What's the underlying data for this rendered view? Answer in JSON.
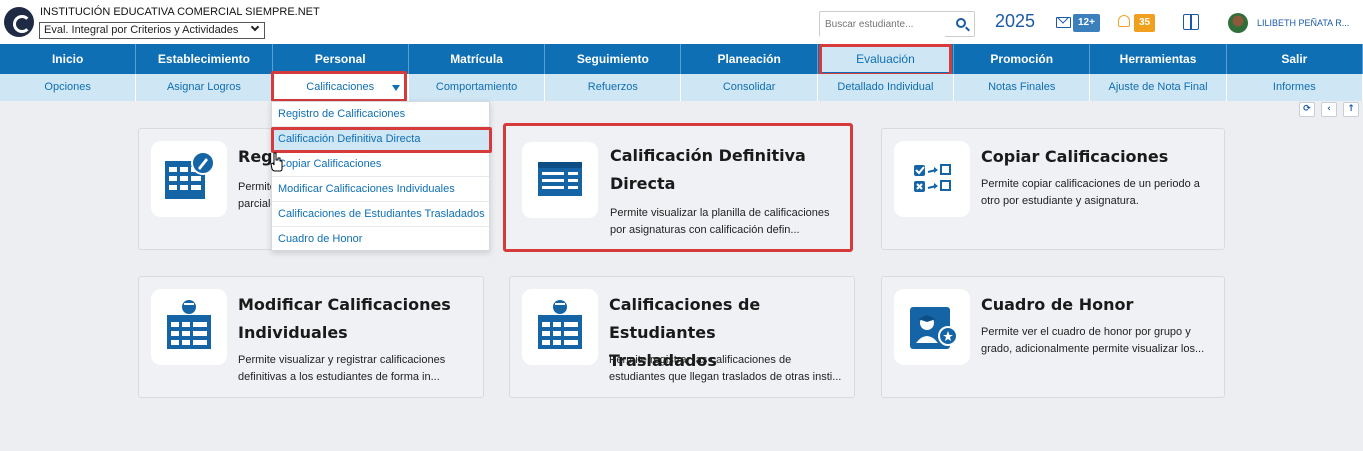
{
  "header": {
    "institution": "INSTITUCIÓN EDUCATIVA COMERCIAL SIEMPRE.NET",
    "period_select": "Eval. Integral por Criterios y Actividades",
    "search_placeholder": "Buscar estudiante...",
    "year": "2025",
    "messages_badge": "12+",
    "notifications_badge": "35",
    "user_name": "LILIBETH PEÑATA R..."
  },
  "nav": {
    "items": [
      "Inicio",
      "Establecimiento",
      "Personal",
      "Matrícula",
      "Seguimiento",
      "Planeación",
      "Evaluación",
      "Promoción",
      "Herramientas",
      "Salir"
    ],
    "active": "Evaluación"
  },
  "subnav": {
    "items": [
      "Opciones",
      "Asignar Logros",
      "Calificaciones",
      "Comportamiento",
      "Refuerzos",
      "Consolidar",
      "Detallado Individual",
      "Notas Finales",
      "Ajuste de Nota Final",
      "Informes"
    ],
    "active": "Calificaciones"
  },
  "dropdown": {
    "items": [
      "Registro de Calificaciones",
      "Calificación Definitiva Directa",
      "Copiar Calificaciones",
      "Modificar Calificaciones Individuales",
      "Calificaciones de Estudiantes Trasladados",
      "Cuadro de Honor"
    ],
    "selected": "Calificación Definitiva Directa"
  },
  "cards": [
    {
      "title": "Regi",
      "desc_1": "Permite",
      "desc_2": "parciale",
      "icon": "grade-register-icon"
    },
    {
      "title_1": "Calificación Definitiva",
      "title_2": "Directa",
      "desc_1": "Permite visualizar la planilla de calificaciones",
      "desc_2": "por asignaturas con calificación defin...",
      "icon": "definitive-grade-icon"
    },
    {
      "title": "Copiar Calificaciones",
      "desc_1": "Permite copiar calificaciones de un periodo a",
      "desc_2": "otro por estudiante y asignatura.",
      "icon": "copy-grades-icon"
    },
    {
      "title_1": "Modificar Calificaciones",
      "title_2": "Individuales",
      "desc_1": "Permite visualizar y registrar calificaciones",
      "desc_2": "definitivas a los estudiantes de forma in...",
      "icon": "modify-grades-icon"
    },
    {
      "title_1": "Calificaciones de Estudiantes",
      "title_2": "Trasladados",
      "desc_1": "Permite registrar las calificaciones de",
      "desc_2": "estudiantes que llegan traslados de otras insti...",
      "icon": "transferred-grades-icon"
    },
    {
      "title": "Cuadro de Honor",
      "desc_1": "Permite ver el cuadro de honor por grupo y",
      "desc_2": "grado, adicionalmente permite visualizar los...",
      "icon": "honor-roll-icon"
    }
  ],
  "colors": {
    "primary": "#0f6fb4",
    "subnav_bg": "#cfe6f4",
    "highlight": "#d63a3a",
    "badge_mail": "#3b7fbd",
    "badge_bell": "#f0a01d"
  }
}
